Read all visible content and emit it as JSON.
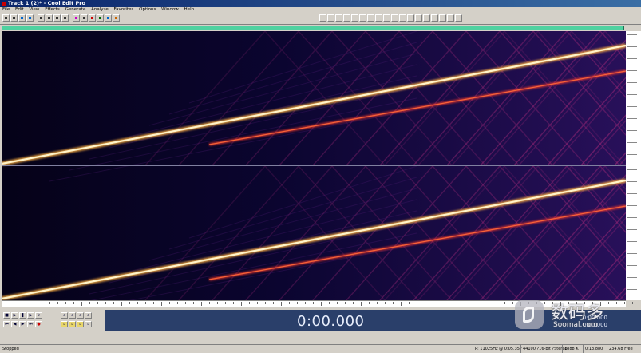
{
  "window": {
    "title": "Track 1 (2)* - Cool Edit Pro"
  },
  "menu": [
    "File",
    "Edit",
    "View",
    "Effects",
    "Generate",
    "Analyze",
    "Favorites",
    "Options",
    "Window",
    "Help"
  ],
  "toolbar_icons": [
    "open-icon",
    "save-icon",
    "undo-icon",
    "redo-icon",
    "cut-icon",
    "copy-icon",
    "paste-icon",
    "mix-paste-icon",
    "spectral-view-icon",
    "settings-icon",
    "record-icon",
    "play-icon",
    "zoom-icon",
    "marker-icon"
  ],
  "colors": {
    "title_bar": "#0a246a",
    "overview_bar": "#4fd1a0",
    "sweep_main": "#fff3c8",
    "sweep_secondary": "#ff3a2a",
    "harmonics": "#a02878",
    "display_bg": "#2a3f6a"
  },
  "transport": {
    "buttons": [
      "stop",
      "play",
      "pause",
      "play-from-cursor",
      "loop",
      "go-start",
      "rewind",
      "fast-forward",
      "go-end",
      "record"
    ],
    "zoom_buttons": [
      "zoom-in-h",
      "zoom-out-h",
      "zoom-full",
      "zoom-sel",
      "zoom-left",
      "zoom-right",
      "zoom-in-v",
      "zoom-out-v"
    ]
  },
  "display": {
    "time": "0:00.000",
    "selection_begin": "0:00.000",
    "selection_end": "0:00.000"
  },
  "status": {
    "state": "Stopped",
    "info": "P: 11025Hz @ 0:05.357",
    "format": "44100 ?16-bit ?Stereo",
    "size": "1888 K",
    "duration": "0:13.880",
    "free": "234.68 Free"
  },
  "watermark": {
    "cn": "数码多",
    "en": "Soomal.com"
  }
}
